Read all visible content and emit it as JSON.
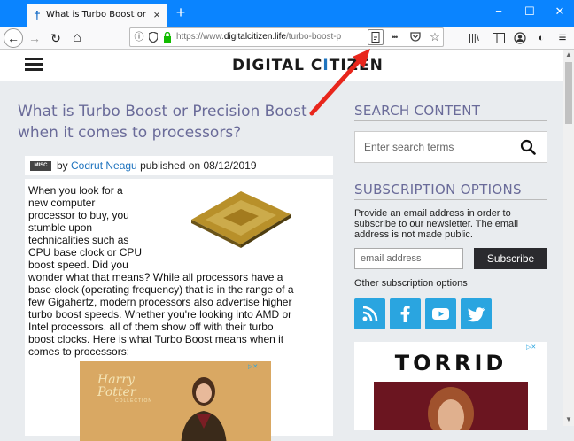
{
  "browser": {
    "tab_title": "What is Turbo Boost or Precision Boost",
    "url_prefix": "https://www.",
    "url_domain": "digitalcitizen.life",
    "url_path": "/turbo-boost-p",
    "tab_close_glyph": "×",
    "new_tab_glyph": "+",
    "window_controls": {
      "minimize": "−",
      "maximize": "☐",
      "close": "✕"
    },
    "nav": {
      "back": "←",
      "forward": "→",
      "reload": "↻",
      "home": "⌂",
      "more": "•••",
      "bookmark": "☆",
      "library": "|||\\",
      "menu": "≡"
    }
  },
  "site": {
    "logo_pre": "DIGITAL C",
    "logo_i": "I",
    "logo_post": "TIZEN"
  },
  "article": {
    "title": "What is Turbo Boost or Precision Boost when it comes to processors?",
    "badge": "MISC",
    "byline_by": "by ",
    "author": "Codrut Neagu",
    "byline_published": " published on 08/12/2019",
    "body_lines": [
      "When you look for a",
      "new computer",
      "processor to buy, you",
      "stumble upon",
      "technicalities such as",
      "CPU base clock or CPU",
      "boost speed. Did you",
      "wonder what that means? While all processors have a",
      "base clock (operating frequency) that is in the range of a",
      "few Gigahertz, modern processors also advertise higher",
      "turbo boost speeds. Whether you're looking into AMD or",
      "Intel processors, all of them show off with their turbo",
      "boost clocks. Here is what Turbo Boost means when it",
      "comes to processors:"
    ],
    "ad": {
      "brand": "Harry Potter",
      "sub": "COLLECTION",
      "choices": "▷✕"
    }
  },
  "sidebar": {
    "search_heading": "SEARCH CONTENT",
    "search_placeholder": "Enter search terms",
    "sub_heading": "SUBSCRIPTION OPTIONS",
    "sub_text": "Provide an email address in order to subscribe to our newsletter. The email address is not made public.",
    "email_placeholder": "email address",
    "subscribe_label": "Subscribe",
    "other_options": "Other subscription options",
    "ad": {
      "brand": "TORRID",
      "choices": "▷✕"
    }
  },
  "colors": {
    "accent_blue": "#0a84ff",
    "heading_purple": "#6a6b99",
    "link_blue": "#1e73be",
    "social_blue": "#2aa5e0",
    "arrow_red": "#e8261c"
  }
}
